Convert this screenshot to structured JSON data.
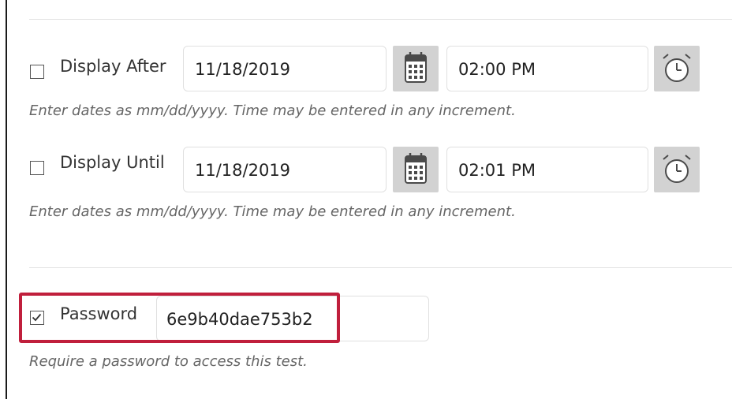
{
  "display_after": {
    "label": "Display After",
    "checked": false,
    "date_value": "11/18/2019",
    "time_value": "02:00 PM",
    "hint": "Enter dates as mm/dd/yyyy. Time may be entered in any increment."
  },
  "display_until": {
    "label": "Display Until",
    "checked": false,
    "date_value": "11/18/2019",
    "time_value": "02:01 PM",
    "hint": "Enter dates as mm/dd/yyyy. Time may be entered in any increment."
  },
  "password": {
    "label": "Password",
    "checked": true,
    "value": "6e9b40dae753b2",
    "hint": "Require a password to access this test."
  },
  "icons": {
    "calendar": "calendar-icon",
    "clock": "clock-icon",
    "check": "checkmark-icon"
  },
  "colors": {
    "highlight": "#c01f3c",
    "icon_button_bg": "#d2d2d2",
    "hint_text": "#666666"
  }
}
